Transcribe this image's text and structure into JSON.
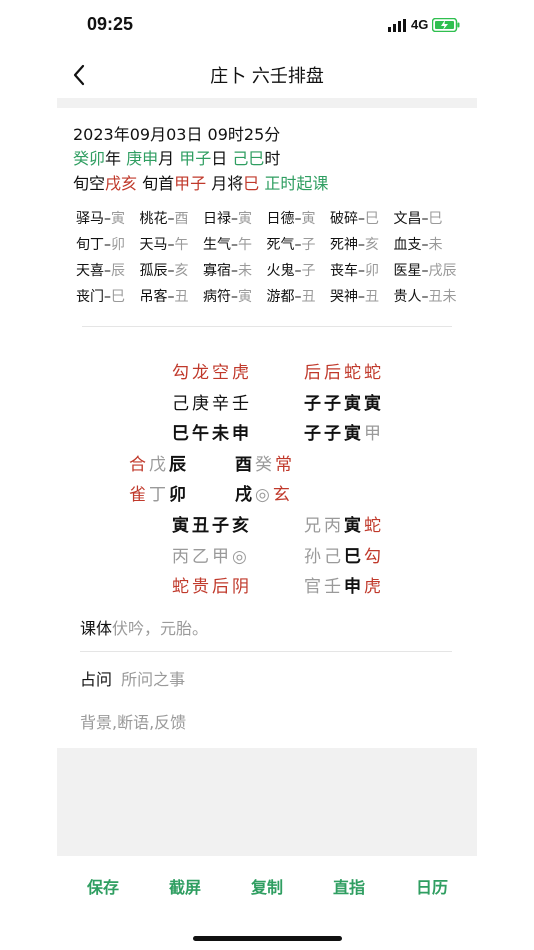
{
  "status": {
    "time": "09:25",
    "network": "4G"
  },
  "nav": {
    "title": "庄卜 六壬排盘"
  },
  "info": {
    "datetime": "2023年09月03日 09时25分",
    "ganzhi": [
      {
        "gz": "癸卯",
        "unit": "年"
      },
      {
        "gz": "庚申",
        "unit": "月"
      },
      {
        "gz": "甲子",
        "unit": "日"
      },
      {
        "gz": "己巳",
        "unit": "时"
      }
    ],
    "xunkong_label": "旬空",
    "xunkong": "戌亥",
    "xunshou_label": "旬首",
    "xunshou": "甲子",
    "yuejiang_label": "月将",
    "yuejiang": "巳",
    "qike": "正时起课"
  },
  "shensha": [
    [
      {
        "n": "驿马",
        "v": "寅"
      },
      {
        "n": "桃花",
        "v": "酉"
      },
      {
        "n": "日禄",
        "v": "寅"
      },
      {
        "n": "日德",
        "v": "寅"
      },
      {
        "n": "破碎",
        "v": "巳"
      },
      {
        "n": "文昌",
        "v": "巳"
      }
    ],
    [
      {
        "n": "旬丁",
        "v": "卯"
      },
      {
        "n": "天马",
        "v": "午"
      },
      {
        "n": "生气",
        "v": "午"
      },
      {
        "n": "死气",
        "v": "子"
      },
      {
        "n": "死神",
        "v": "亥"
      },
      {
        "n": "血支",
        "v": "未"
      }
    ],
    [
      {
        "n": "天喜",
        "v": "辰"
      },
      {
        "n": "孤辰",
        "v": "亥"
      },
      {
        "n": "寡宿",
        "v": "未"
      },
      {
        "n": "火鬼",
        "v": "子"
      },
      {
        "n": "丧车",
        "v": "卯"
      },
      {
        "n": "医星",
        "v": "戌辰"
      }
    ],
    [
      {
        "n": "丧门",
        "v": "巳"
      },
      {
        "n": "吊客",
        "v": "丑"
      },
      {
        "n": "病符",
        "v": "寅"
      },
      {
        "n": "游都",
        "v": "丑"
      },
      {
        "n": "哭神",
        "v": "丑"
      },
      {
        "n": "贵人",
        "v": "丑未"
      }
    ]
  ],
  "sike": {
    "jiang": "勾龙空虎",
    "top": "己庚辛壬",
    "mid": "巳午未申"
  },
  "sanchuan": {
    "jiang": "后后蛇蛇",
    "top": "子子寅寅",
    "mid": [
      "子",
      "子",
      "寅"
    ],
    "mid_gray": "甲"
  },
  "tianpan": {
    "left_top_jiang": "合",
    "left_top_gan": "戊",
    "left_top_zhi": "辰",
    "right_top_zhi": "酉",
    "right_top_gan": "癸",
    "right_top_jiang": "常",
    "left_bot_jiang": "雀",
    "left_bot_gan": "丁",
    "left_bot_zhi": "卯",
    "right_bot_zhi": "戌",
    "right_bot_gan": "◎",
    "right_bot_jiang": "玄"
  },
  "dipan": {
    "zhi": "寅丑子亥",
    "gan": "丙乙甲◎",
    "jiang": "蛇贵后阴"
  },
  "chuan": [
    {
      "liuqin": "兄",
      "gan": "丙",
      "zhi": "寅",
      "jiang": "蛇"
    },
    {
      "liuqin": "孙",
      "gan": "己",
      "zhi": "巳",
      "jiang": "勾"
    },
    {
      "liuqin": "官",
      "gan": "壬",
      "zhi": "申",
      "jiang": "虎"
    }
  ],
  "keti": {
    "label": "课体",
    "value": "伏吟，元胎。"
  },
  "zhanwen": {
    "label": "占问",
    "placeholder": "所问之事"
  },
  "notes": {
    "placeholder": "背景,断语,反馈"
  },
  "toolbar": [
    "保存",
    "截屏",
    "复制",
    "直指",
    "日历"
  ],
  "colors": {
    "green": "#2f9e61",
    "red": "#c0392b",
    "gray": "#9a9a9a"
  }
}
